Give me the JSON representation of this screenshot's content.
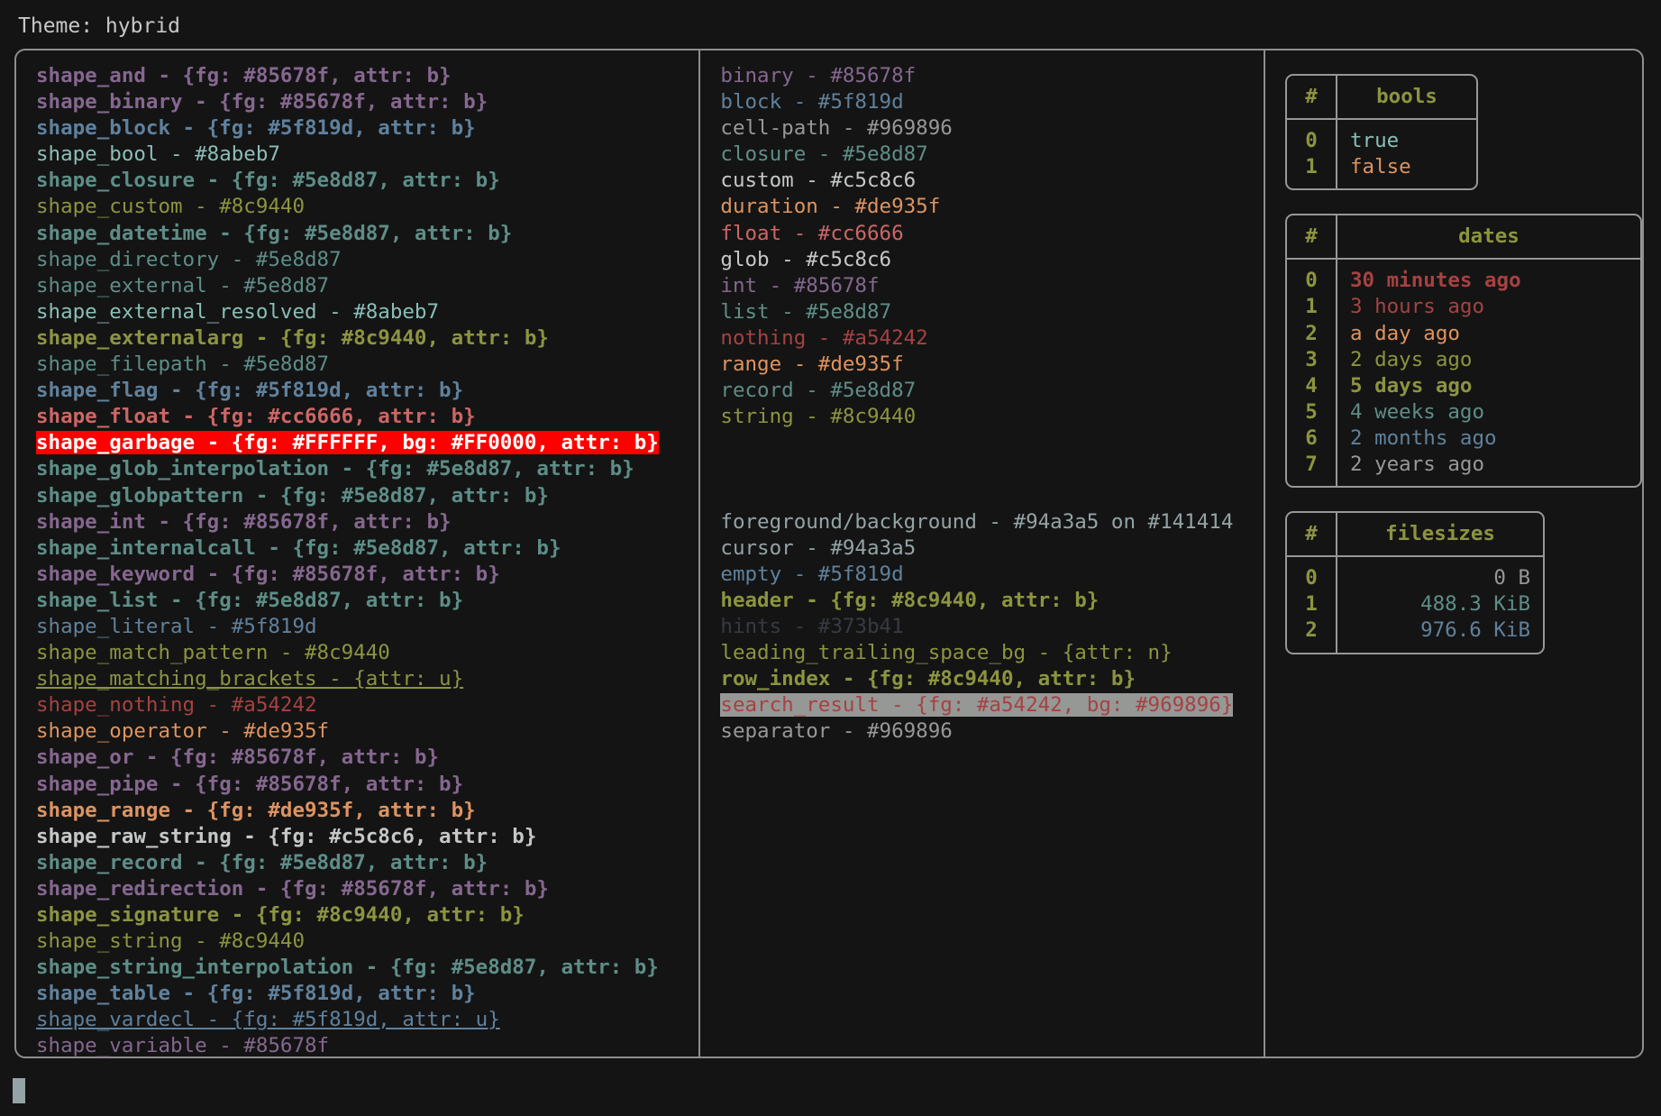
{
  "header": {
    "theme_label": "Theme: hybrid"
  },
  "colors": {
    "background": "#141414",
    "foreground": "#94a3a5",
    "border": "#8d8f8d",
    "table_border": "#969896",
    "purple": "#85678f",
    "blue": "#5f819d",
    "cyan": "#8abeb7",
    "teal": "#5e8d87",
    "olive": "#8c9440",
    "red": "#cc6666",
    "darkred": "#a54242",
    "orange": "#de935f",
    "white": "#c5c8c6",
    "gray": "#969896",
    "hint": "#373b41",
    "garbage_fg": "#FFFFFF",
    "garbage_bg": "#FF0000",
    "search_bg": "#969896",
    "cursor": "#94a3a5"
  },
  "shapes": [
    {
      "text": "shape_and - {fg: #85678f, attr: b}",
      "color": "#85678f",
      "bold": true,
      "underline": false
    },
    {
      "text": "shape_binary - {fg: #85678f, attr: b}",
      "color": "#85678f",
      "bold": true,
      "underline": false
    },
    {
      "text": "shape_block - {fg: #5f819d, attr: b}",
      "color": "#5f819d",
      "bold": true,
      "underline": false
    },
    {
      "text": "shape_bool - #8abeb7",
      "color": "#8abeb7",
      "bold": false,
      "underline": false
    },
    {
      "text": "shape_closure - {fg: #5e8d87, attr: b}",
      "color": "#5e8d87",
      "bold": true,
      "underline": false
    },
    {
      "text": "shape_custom - #8c9440",
      "color": "#8c9440",
      "bold": false,
      "underline": false
    },
    {
      "text": "shape_datetime - {fg: #5e8d87, attr: b}",
      "color": "#5e8d87",
      "bold": true,
      "underline": false
    },
    {
      "text": "shape_directory - #5e8d87",
      "color": "#5e8d87",
      "bold": false,
      "underline": false
    },
    {
      "text": "shape_external - #5e8d87",
      "color": "#5e8d87",
      "bold": false,
      "underline": false
    },
    {
      "text": "shape_external_resolved - #8abeb7",
      "color": "#8abeb7",
      "bold": false,
      "underline": false
    },
    {
      "text": "shape_externalarg - {fg: #8c9440, attr: b}",
      "color": "#8c9440",
      "bold": true,
      "underline": false
    },
    {
      "text": "shape_filepath - #5e8d87",
      "color": "#5e8d87",
      "bold": false,
      "underline": false
    },
    {
      "text": "shape_flag - {fg: #5f819d, attr: b}",
      "color": "#5f819d",
      "bold": true,
      "underline": false
    },
    {
      "text": "shape_float - {fg: #cc6666, attr: b}",
      "color": "#cc6666",
      "bold": true,
      "underline": false
    },
    {
      "text": "shape_garbage - {fg: #FFFFFF, bg: #FF0000, attr: b}",
      "color": "#FFFFFF",
      "bg": "#FF0000",
      "bold": true,
      "underline": false
    },
    {
      "text": "shape_glob_interpolation - {fg: #5e8d87, attr: b}",
      "color": "#5e8d87",
      "bold": true,
      "underline": false
    },
    {
      "text": "shape_globpattern - {fg: #5e8d87, attr: b}",
      "color": "#5e8d87",
      "bold": true,
      "underline": false
    },
    {
      "text": "shape_int - {fg: #85678f, attr: b}",
      "color": "#85678f",
      "bold": true,
      "underline": false
    },
    {
      "text": "shape_internalcall - {fg: #5e8d87, attr: b}",
      "color": "#5e8d87",
      "bold": true,
      "underline": false
    },
    {
      "text": "shape_keyword - {fg: #85678f, attr: b}",
      "color": "#85678f",
      "bold": true,
      "underline": false
    },
    {
      "text": "shape_list - {fg: #5e8d87, attr: b}",
      "color": "#5e8d87",
      "bold": true,
      "underline": false
    },
    {
      "text": "shape_literal - #5f819d",
      "color": "#5f819d",
      "bold": false,
      "underline": false
    },
    {
      "text": "shape_match_pattern - #8c9440",
      "color": "#8c9440",
      "bold": false,
      "underline": false
    },
    {
      "text": "shape_matching_brackets - {attr: u}",
      "color": "#8c9440",
      "bold": false,
      "underline": true
    },
    {
      "text": "shape_nothing - #a54242",
      "color": "#a54242",
      "bold": false,
      "underline": false
    },
    {
      "text": "shape_operator - #de935f",
      "color": "#de935f",
      "bold": false,
      "underline": false
    },
    {
      "text": "shape_or - {fg: #85678f, attr: b}",
      "color": "#85678f",
      "bold": true,
      "underline": false
    },
    {
      "text": "shape_pipe - {fg: #85678f, attr: b}",
      "color": "#85678f",
      "bold": true,
      "underline": false
    },
    {
      "text": "shape_range - {fg: #de935f, attr: b}",
      "color": "#de935f",
      "bold": true,
      "underline": false
    },
    {
      "text": "shape_raw_string - {fg: #c5c8c6, attr: b}",
      "color": "#c5c8c6",
      "bold": true,
      "underline": false
    },
    {
      "text": "shape_record - {fg: #5e8d87, attr: b}",
      "color": "#5e8d87",
      "bold": true,
      "underline": false
    },
    {
      "text": "shape_redirection - {fg: #85678f, attr: b}",
      "color": "#85678f",
      "bold": true,
      "underline": false
    },
    {
      "text": "shape_signature - {fg: #8c9440, attr: b}",
      "color": "#8c9440",
      "bold": true,
      "underline": false
    },
    {
      "text": "shape_string - #8c9440",
      "color": "#8c9440",
      "bold": false,
      "underline": false
    },
    {
      "text": "shape_string_interpolation - {fg: #5e8d87, attr: b}",
      "color": "#5e8d87",
      "bold": true,
      "underline": false
    },
    {
      "text": "shape_table - {fg: #5f819d, attr: b}",
      "color": "#5f819d",
      "bold": true,
      "underline": false
    },
    {
      "text": "shape_vardecl - {fg: #5f819d, attr: u}",
      "color": "#5f819d",
      "bold": false,
      "underline": true
    },
    {
      "text": "shape_variable - #85678f",
      "color": "#85678f",
      "bold": false,
      "underline": false
    }
  ],
  "types": [
    {
      "text": "binary - #85678f",
      "color": "#85678f",
      "bold": false,
      "underline": false
    },
    {
      "text": "block - #5f819d",
      "color": "#5f819d",
      "bold": false,
      "underline": false
    },
    {
      "text": "cell-path - #969896",
      "color": "#969896",
      "bold": false,
      "underline": false
    },
    {
      "text": "closure - #5e8d87",
      "color": "#5e8d87",
      "bold": false,
      "underline": false
    },
    {
      "text": "custom - #c5c8c6",
      "color": "#c5c8c6",
      "bold": false,
      "underline": false
    },
    {
      "text": "duration - #de935f",
      "color": "#de935f",
      "bold": false,
      "underline": false
    },
    {
      "text": "float - #cc6666",
      "color": "#cc6666",
      "bold": false,
      "underline": false
    },
    {
      "text": "glob - #c5c8c6",
      "color": "#c5c8c6",
      "bold": false,
      "underline": false
    },
    {
      "text": "int - #85678f",
      "color": "#85678f",
      "bold": false,
      "underline": false
    },
    {
      "text": "list - #5e8d87",
      "color": "#5e8d87",
      "bold": false,
      "underline": false
    },
    {
      "text": "nothing - #a54242",
      "color": "#a54242",
      "bold": false,
      "underline": false
    },
    {
      "text": "range - #de935f",
      "color": "#de935f",
      "bold": false,
      "underline": false
    },
    {
      "text": "record - #5e8d87",
      "color": "#5e8d87",
      "bold": false,
      "underline": false
    },
    {
      "text": "string - #8c9440",
      "color": "#8c9440",
      "bold": false,
      "underline": false
    }
  ],
  "ui_elements": [
    {
      "text": "foreground/background - #94a3a5 on #141414",
      "color": "#94a3a5",
      "bold": false,
      "underline": false
    },
    {
      "text": "cursor - #94a3a5",
      "color": "#94a3a5",
      "bold": false,
      "underline": false
    },
    {
      "text": "empty - #5f819d",
      "color": "#5f819d",
      "bold": false,
      "underline": false
    },
    {
      "text": "header - {fg: #8c9440, attr: b}",
      "color": "#8c9440",
      "bold": true,
      "underline": false
    },
    {
      "text": "hints - #373b41",
      "color": "#373b41",
      "bold": false,
      "underline": false
    },
    {
      "text": "leading_trailing_space_bg - {attr: n}",
      "color": "#8c9440",
      "bold": false,
      "underline": false
    },
    {
      "text": "row_index - {fg: #8c9440, attr: b}",
      "color": "#8c9440",
      "bold": true,
      "underline": false
    },
    {
      "text": "search_result - {fg: #a54242, bg: #969896}",
      "color": "#a54242",
      "bg": "#969896",
      "bold": false,
      "underline": false
    },
    {
      "text": "separator - #969896",
      "color": "#969896",
      "bold": false,
      "underline": false
    }
  ],
  "tables": [
    {
      "name": "bools",
      "index_header": "#",
      "value_header": "bools",
      "width_class": "w-bools",
      "rows": [
        {
          "index": "0",
          "value": "true",
          "color": "#8abeb7",
          "bold": false
        },
        {
          "index": "1",
          "value": "false",
          "color": "#de935f",
          "bold": false
        }
      ]
    },
    {
      "name": "dates",
      "index_header": "#",
      "value_header": "dates",
      "width_class": "w-dates",
      "rows": [
        {
          "index": "0",
          "value": "30 minutes ago",
          "color": "#a54242",
          "bold": true
        },
        {
          "index": "1",
          "value": "3 hours ago",
          "color": "#a54242",
          "bold": false
        },
        {
          "index": "2",
          "value": "a day ago",
          "color": "#de935f",
          "bold": false
        },
        {
          "index": "3",
          "value": "2 days ago",
          "color": "#8c9440",
          "bold": false
        },
        {
          "index": "4",
          "value": "5 days ago",
          "color": "#8c9440",
          "bold": true
        },
        {
          "index": "5",
          "value": "4 weeks ago",
          "color": "#5e8d87",
          "bold": false
        },
        {
          "index": "6",
          "value": "2 months ago",
          "color": "#5f819d",
          "bold": false
        },
        {
          "index": "7",
          "value": "2 years ago",
          "color": "#969896",
          "bold": false
        }
      ]
    },
    {
      "name": "filesizes",
      "index_header": "#",
      "value_header": "filesizes",
      "width_class": "w-sizes",
      "rows": [
        {
          "index": "0",
          "value": "0 B",
          "color": "#969896",
          "bold": false
        },
        {
          "index": "1",
          "value": "488.3 KiB",
          "color": "#5e8d87",
          "bold": false
        },
        {
          "index": "2",
          "value": "976.6 KiB",
          "color": "#5f819d",
          "bold": false
        }
      ]
    }
  ]
}
